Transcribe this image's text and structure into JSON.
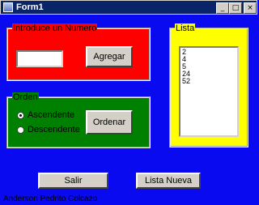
{
  "window": {
    "title": "Form1",
    "minimize_glyph": "_",
    "maximize_glyph": "□",
    "close_glyph": "×"
  },
  "frame_numero": {
    "label": "Introduce un Numero",
    "color": "#ff0000",
    "input_value": "",
    "agregar_label": "Agregar"
  },
  "frame_orden": {
    "label": "Orden",
    "color": "#008000",
    "radio_asc_label": "Ascendente",
    "radio_desc_label": "Descendente",
    "selected": "Ascendente",
    "ordenar_label": "Ordenar"
  },
  "frame_lista": {
    "label": "Lista",
    "color": "#ffff00",
    "items": [
      "2",
      "4",
      "5",
      "24",
      "52"
    ]
  },
  "buttons": {
    "salir_label": "Salir",
    "lista_nueva_label": "Lista Nueva"
  },
  "status_text": "Anderson Pedrito Colcazo"
}
